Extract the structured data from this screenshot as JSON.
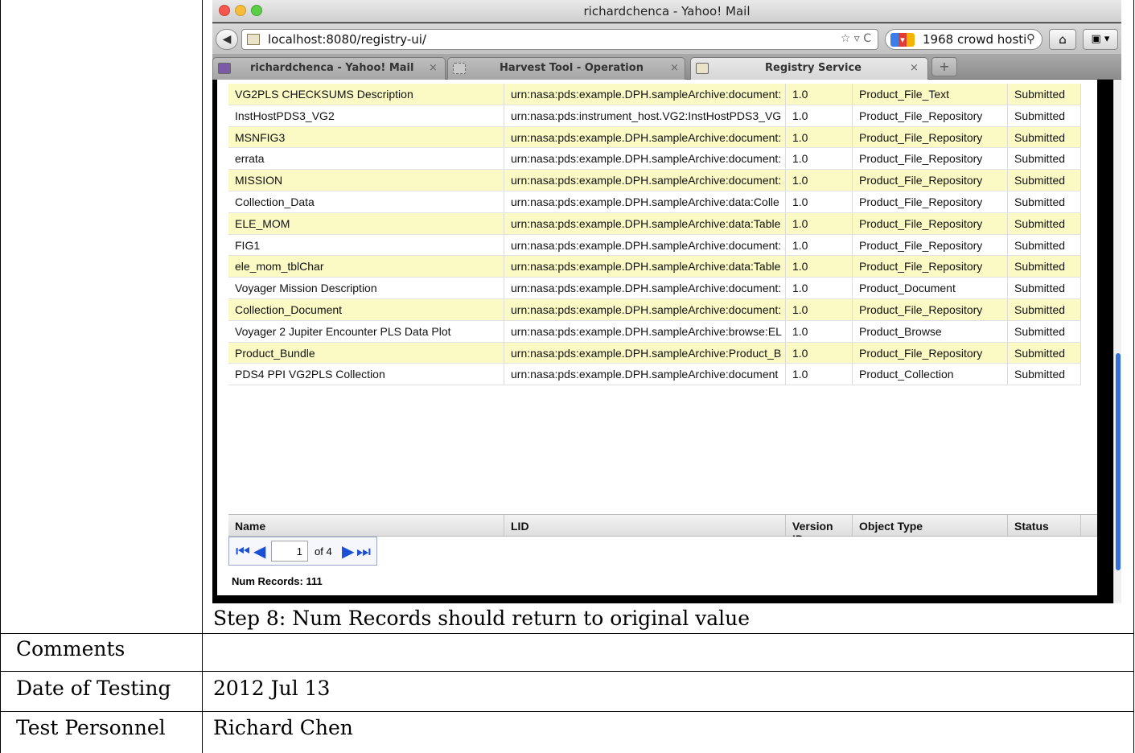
{
  "browser": {
    "window_title": "richardchenca - Yahoo! Mail",
    "url": "localhost:8080/registry-ui/",
    "search_text": "1968 crowd hosti",
    "tabs": [
      {
        "label": "richardchenca - Yahoo! Mail",
        "active": false
      },
      {
        "label": "Harvest Tool - Operation",
        "active": false
      },
      {
        "label": "Registry Service",
        "active": true
      }
    ]
  },
  "registry": {
    "rows": [
      {
        "name": "VG2PLS CHECKSUMS Description",
        "lid": "urn:nasa:pds:example.DPH.sampleArchive:document:",
        "version": "1.0",
        "type": "Product_File_Text",
        "status": "Submitted"
      },
      {
        "name": "InstHostPDS3_VG2",
        "lid": "urn:nasa:pds:instrument_host.VG2:InstHostPDS3_VG",
        "version": "1.0",
        "type": "Product_File_Repository",
        "status": "Submitted"
      },
      {
        "name": "MSNFIG3",
        "lid": "urn:nasa:pds:example.DPH.sampleArchive:document:",
        "version": "1.0",
        "type": "Product_File_Repository",
        "status": "Submitted"
      },
      {
        "name": "errata",
        "lid": "urn:nasa:pds:example.DPH.sampleArchive:document:",
        "version": "1.0",
        "type": "Product_File_Repository",
        "status": "Submitted"
      },
      {
        "name": "MISSION",
        "lid": "urn:nasa:pds:example.DPH.sampleArchive:document:",
        "version": "1.0",
        "type": "Product_File_Repository",
        "status": "Submitted"
      },
      {
        "name": "Collection_Data",
        "lid": "urn:nasa:pds:example.DPH.sampleArchive:data:Colle",
        "version": "1.0",
        "type": "Product_File_Repository",
        "status": "Submitted"
      },
      {
        "name": "ELE_MOM",
        "lid": "urn:nasa:pds:example.DPH.sampleArchive:data:Table",
        "version": "1.0",
        "type": "Product_File_Repository",
        "status": "Submitted"
      },
      {
        "name": "FIG1",
        "lid": "urn:nasa:pds:example.DPH.sampleArchive:document:",
        "version": "1.0",
        "type": "Product_File_Repository",
        "status": "Submitted"
      },
      {
        "name": "ele_mom_tblChar",
        "lid": "urn:nasa:pds:example.DPH.sampleArchive:data:Table",
        "version": "1.0",
        "type": "Product_File_Repository",
        "status": "Submitted"
      },
      {
        "name": "Voyager Mission Description",
        "lid": "urn:nasa:pds:example.DPH.sampleArchive:document:",
        "version": "1.0",
        "type": "Product_Document",
        "status": "Submitted"
      },
      {
        "name": "Collection_Document",
        "lid": "urn:nasa:pds:example.DPH.sampleArchive:document:",
        "version": "1.0",
        "type": "Product_File_Repository",
        "status": "Submitted"
      },
      {
        "name": "Voyager 2 Jupiter Encounter PLS Data Plot",
        "lid": "urn:nasa:pds:example.DPH.sampleArchive:browse:EL",
        "version": "1.0",
        "type": "Product_Browse",
        "status": "Submitted"
      },
      {
        "name": "Product_Bundle",
        "lid": "urn:nasa:pds:example.DPH.sampleArchive:Product_B",
        "version": "1.0",
        "type": "Product_File_Repository",
        "status": "Submitted"
      },
      {
        "name": "PDS4 PPI VG2PLS Collection",
        "lid": "urn:nasa:pds:example.DPH.sampleArchive:document",
        "version": "1.0",
        "type": "Product_Collection",
        "status": "Submitted"
      }
    ],
    "columns": {
      "name": "Name",
      "lid": "LID",
      "version": "Version ID",
      "type": "Object Type",
      "status": "Status"
    },
    "pager": {
      "page": "1",
      "of_label": "of 4"
    },
    "num_records": "Num Records: 111",
    "row_highlight_color": "#fbfac4"
  },
  "document": {
    "caption": "Step 8: Num Records should return to original value",
    "comments_label": "Comments",
    "comments_value": "",
    "date_label": "Date of Testing",
    "date_value": "2012 Jul 13",
    "personnel_label": "Test Personnel",
    "personnel_value": "Richard Chen"
  }
}
